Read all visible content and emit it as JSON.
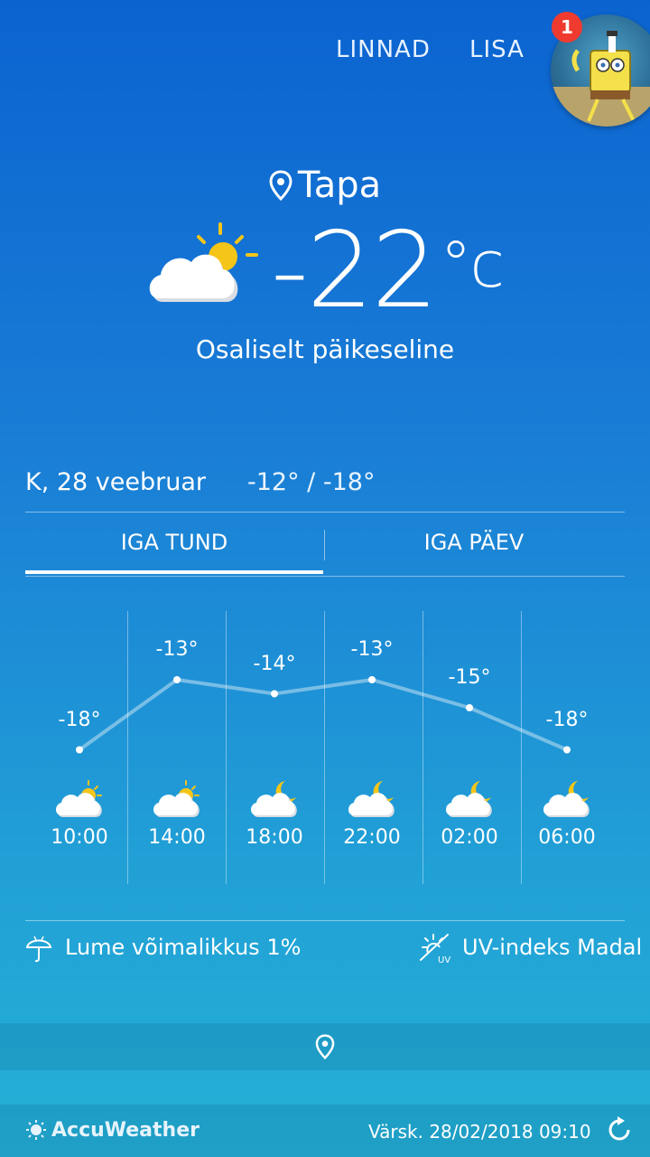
{
  "nav": {
    "cities_label": "LINNAD",
    "more_label": "LISA",
    "badge_count": "1"
  },
  "current": {
    "location": "Tapa",
    "temperature": "-22",
    "unit": "°c",
    "condition": "Osaliselt päikeseline",
    "icon": "partly-sunny-icon"
  },
  "day": {
    "date": "K, 28 veebruar",
    "hi_lo": "-12° / -18°"
  },
  "tabs": {
    "hourly": "IGA TUND",
    "daily": "IGA PÄEV"
  },
  "hourly": [
    {
      "time": "10:00",
      "temp": "-18°",
      "value": -18,
      "icon": "cloud-sun-icon"
    },
    {
      "time": "14:00",
      "temp": "-13°",
      "value": -13,
      "icon": "cloud-sun-icon"
    },
    {
      "time": "18:00",
      "temp": "-14°",
      "value": -14,
      "icon": "cloud-moon-icon"
    },
    {
      "time": "22:00",
      "temp": "-13°",
      "value": -13,
      "icon": "cloud-moon-icon"
    },
    {
      "time": "02:00",
      "temp": "-15°",
      "value": -15,
      "icon": "cloud-moon-icon"
    },
    {
      "time": "06:00",
      "temp": "-18°",
      "value": -18,
      "icon": "cloud-moon-icon"
    }
  ],
  "details": {
    "snow": "Lume võimalikkus 1%",
    "uv": "UV-indeks Madal"
  },
  "footer": {
    "brand": "AccuWeather",
    "updated": "Värsk. 28/02/2018 09:10"
  },
  "colors": {
    "bg_top": "#0b63d0",
    "bg_bottom": "#25b1d6",
    "badge": "#ef3b2f",
    "sun": "#f5c518"
  }
}
